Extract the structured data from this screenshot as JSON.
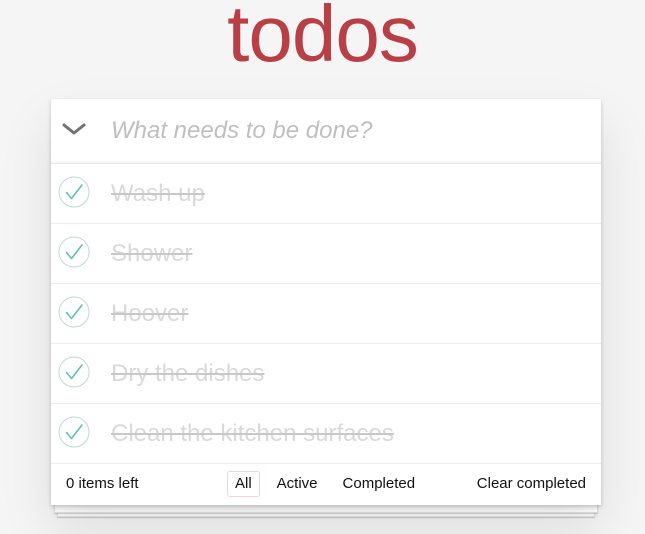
{
  "app": {
    "title": "todos",
    "accent_color": "#b83f45",
    "check_color": "#5dc2af"
  },
  "new_todo": {
    "placeholder": "What needs to be done?",
    "value": "",
    "toggle_all_icon": "chevron-down-icon"
  },
  "todos": [
    {
      "label": "Wash up",
      "completed": true,
      "check_icon": "check-circle-icon"
    },
    {
      "label": "Shower",
      "completed": true,
      "check_icon": "check-circle-icon"
    },
    {
      "label": "Hoover",
      "completed": true,
      "check_icon": "check-circle-icon"
    },
    {
      "label": "Dry the dishes",
      "completed": true,
      "check_icon": "check-circle-icon"
    },
    {
      "label": "Clean the kitchen surfaces",
      "completed": true,
      "check_icon": "check-circle-icon"
    }
  ],
  "footer": {
    "count_text": "0 items left",
    "filters": [
      {
        "label": "All",
        "selected": true
      },
      {
        "label": "Active",
        "selected": false
      },
      {
        "label": "Completed",
        "selected": false
      }
    ],
    "clear_label": "Clear completed"
  }
}
